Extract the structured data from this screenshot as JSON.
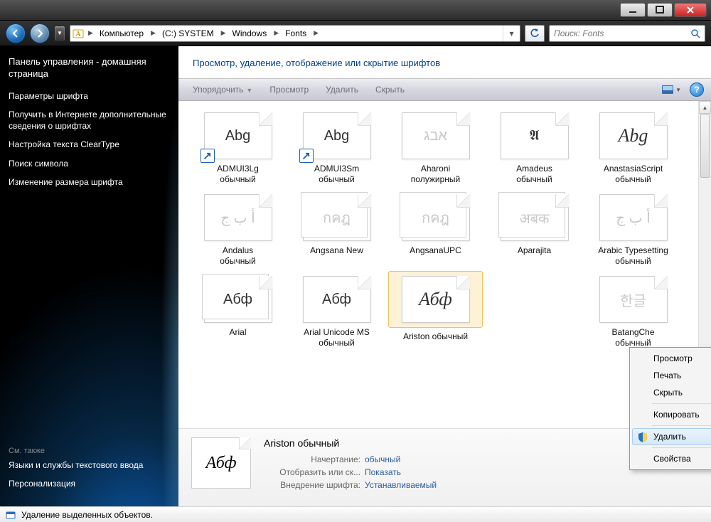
{
  "breadcrumb": {
    "items": [
      "Компьютер",
      "(C:) SYSTEM",
      "Windows",
      "Fonts"
    ]
  },
  "search": {
    "placeholder": "Поиск: Fonts"
  },
  "sidebar": {
    "header": "Панель управления - домашняя страница",
    "links": [
      "Параметры шрифта",
      "Получить в Интернете дополнительные сведения о шрифтах",
      "Настройка текста ClearType",
      "Поиск символа",
      "Изменение размера шрифта"
    ],
    "seeAlsoLabel": "См. также",
    "footerLinks": [
      "Языки и службы текстового ввода",
      "Персонализация"
    ]
  },
  "content": {
    "heading": "Просмотр, удаление, отображение или скрытие шрифтов"
  },
  "toolbar": {
    "organize": "Упорядочить",
    "preview": "Просмотр",
    "delete": "Удалить",
    "hide": "Скрыть"
  },
  "fonts": [
    {
      "sample": "Abg",
      "name": "ADMUI3Lg",
      "sub": "обычный",
      "shortcut": true
    },
    {
      "sample": "Abg",
      "name": "ADMUI3Sm",
      "sub": "обычный",
      "shortcut": true
    },
    {
      "sample": "אבג",
      "name": "Aharoni",
      "sub": "полужирный",
      "faded": true
    },
    {
      "sample": "𝕬",
      "name": "Amadeus",
      "sub": "обычный",
      "ornate": true
    },
    {
      "sample": "Abg",
      "name": "AnastasiaScript",
      "sub": "обычный",
      "script": true
    },
    {
      "sample": "أ ب ج",
      "name": "Andalus",
      "sub": "обычный",
      "faded": true
    },
    {
      "sample": "กคฎ",
      "name": "Angsana New",
      "sub": "",
      "stack": true,
      "faded": true
    },
    {
      "sample": "กคฎ",
      "name": "AngsanaUPC",
      "sub": "",
      "stack": true,
      "faded": true
    },
    {
      "sample": "अबक",
      "name": "Aparajita",
      "sub": "",
      "stack": true,
      "faded": true
    },
    {
      "sample": "أ ب ج",
      "name": "Arabic Typesetting",
      "sub": "обычный",
      "faded": true
    },
    {
      "sample": "Абф",
      "name": "Arial",
      "sub": "",
      "stack": true
    },
    {
      "sample": "Абф",
      "name": "Arial Unicode MS",
      "sub": "обычный"
    },
    {
      "sample": "Абф",
      "name": "Ariston обычный",
      "sub": "",
      "selected": true,
      "script": true
    },
    {
      "sample": "",
      "name": "",
      "sub": ""
    },
    {
      "sample": "한글",
      "name": "BatangChe",
      "sub": "обычный",
      "faded": true
    }
  ],
  "details": {
    "title": "Ariston обычный",
    "sample": "Абф",
    "rows": [
      {
        "k": "Начертание:",
        "v": "обычный"
      },
      {
        "k": "Отобразить или ск...",
        "v": "Показать"
      },
      {
        "k": "Внедрение шрифта:",
        "v": "Устанавливаемый"
      }
    ]
  },
  "contextMenu": {
    "items": [
      "Просмотр",
      "Печать",
      "Скрыть"
    ],
    "items2": [
      "Копировать"
    ],
    "highlightItem": "Удалить",
    "items3": [
      "Свойства"
    ]
  },
  "statusbar": {
    "text": "Удаление выделенных объектов."
  }
}
